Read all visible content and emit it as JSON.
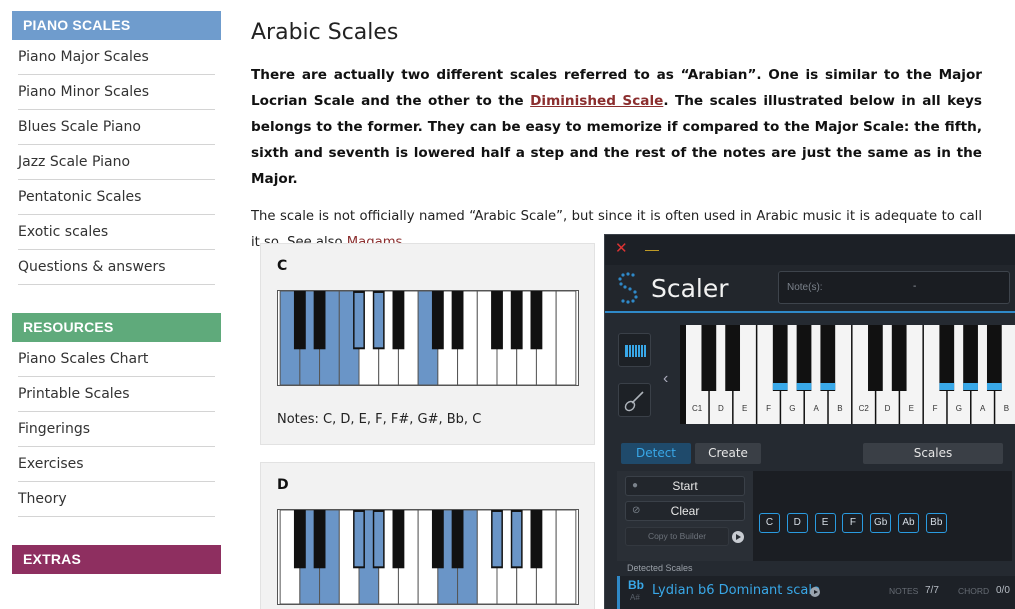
{
  "sidebar": {
    "piano_scales": {
      "heading": "PIANO SCALES",
      "items": [
        "Piano Major Scales",
        "Piano Minor Scales",
        "Blues Scale Piano",
        "Jazz Scale Piano",
        "Pentatonic Scales",
        "Exotic scales",
        "Questions & answers"
      ]
    },
    "resources": {
      "heading": "RESOURCES",
      "items": [
        "Piano Scales Chart",
        "Printable Scales",
        "Fingerings",
        "Exercises",
        "Theory"
      ]
    },
    "extras": {
      "heading": "EXTRAS"
    }
  },
  "article": {
    "title": "Arabic Scales",
    "intro_part1": "There are actually two different scales referred to as “Arabian”. One is similar to the Major Locrian Scale and the other to the ",
    "intro_link": "Diminished Scale",
    "intro_part2": ". The scales illustrated below in all keys belongs to the former. They can be easy to memorize if compared to the Major Scale: the fifth, sixth and seventh is lowered half a step and the rest of the notes are just the same as in the Major.",
    "para_part1": "The scale is not officially named “Arabic Scale”, but since it is often used in Arabic music it is adequate to call it so. See also ",
    "para_link": "Maqams",
    "para_part2": ".",
    "scales": [
      {
        "key": "C",
        "notes": "Notes: C, D, E, F, F#, G#, Bb, C"
      },
      {
        "key": "D"
      }
    ]
  },
  "scaler": {
    "app_name": "Scaler",
    "notes_placeholder": "Note(s):",
    "notes_value": "-",
    "tabs": {
      "detect": "Detect",
      "create": "Create",
      "scales": "Scales"
    },
    "buttons": {
      "start": "Start",
      "clear": "Clear",
      "copy": "Copy to Builder"
    },
    "keyboard_labels": [
      "C1",
      "D",
      "E",
      "F",
      "G",
      "A",
      "B",
      "C2",
      "D",
      "E",
      "F",
      "G",
      "A",
      "B"
    ],
    "chips": [
      "C",
      "D",
      "E",
      "F",
      "Gb",
      "Ab",
      "Bb"
    ],
    "detected_label": "Detected Scales",
    "result": {
      "key": "Bb",
      "alt_key": "A#",
      "name": "Lydian b6 Dominant scale",
      "notes_label": "NOTES",
      "notes_value": "7/7",
      "chord_label": "CHORD",
      "chord_value": "0/0"
    },
    "colors": {
      "accent": "#2f89c8",
      "highlight": "#39a8e8"
    }
  },
  "colors": {
    "piano_scales_head": "#6f9ccd",
    "resources_head": "#5faa7b",
    "extras_head": "#8e2f60",
    "scale_key_fill": "#6a95c7",
    "link": "#8b2e2e"
  }
}
